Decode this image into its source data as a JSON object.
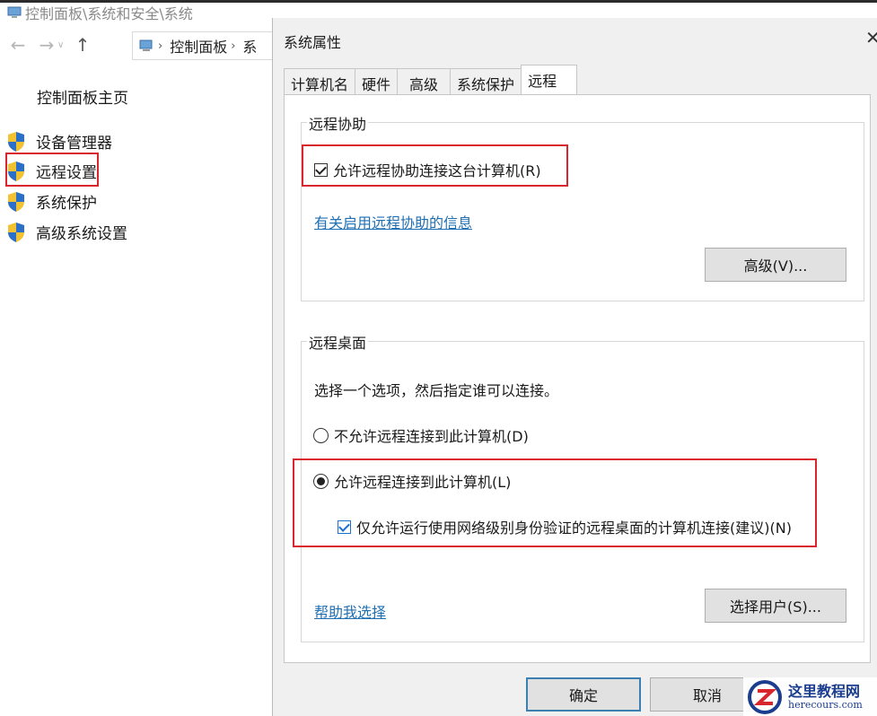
{
  "background_window": {
    "title": "控制面板\\系统和安全\\系统",
    "address": [
      "控制面板",
      "系"
    ],
    "sidebar_home": "控制面板主页",
    "sidebar_items": [
      "设备管理器",
      "远程设置",
      "系统保护",
      "高级系统设置"
    ]
  },
  "dialog": {
    "title": "系统属性",
    "tabs": [
      "计算机名",
      "硬件",
      "高级",
      "系统保护",
      "远程"
    ],
    "active_tab": "远程",
    "remote_assistance": {
      "group_label": "远程协助",
      "allow_label": "允许远程协助连接这台计算机(R)",
      "allow_checked": true,
      "info_link": "有关启用远程协助的信息",
      "advanced_button": "高级(V)..."
    },
    "remote_desktop": {
      "group_label": "远程桌面",
      "instruction": "选择一个选项，然后指定谁可以连接。",
      "option_deny": "不允许远程连接到此计算机(D)",
      "option_allow": "允许远程连接到此计算机(L)",
      "selected": "allow",
      "nla_label": "仅允许运行使用网络级别身份验证的远程桌面的计算机连接(建议)(N)",
      "nla_checked": true,
      "help_link": "帮助我选择",
      "select_users_button": "选择用户(S)..."
    },
    "ok_button": "确定",
    "cancel_button_partial": "取消"
  },
  "watermark": {
    "cn": "这里教程网",
    "en": "herecours.com"
  },
  "colors": {
    "highlight_red": "#d9262c",
    "link_blue": "#1f6fb3",
    "dialog_bg": "#f0f0f0"
  }
}
